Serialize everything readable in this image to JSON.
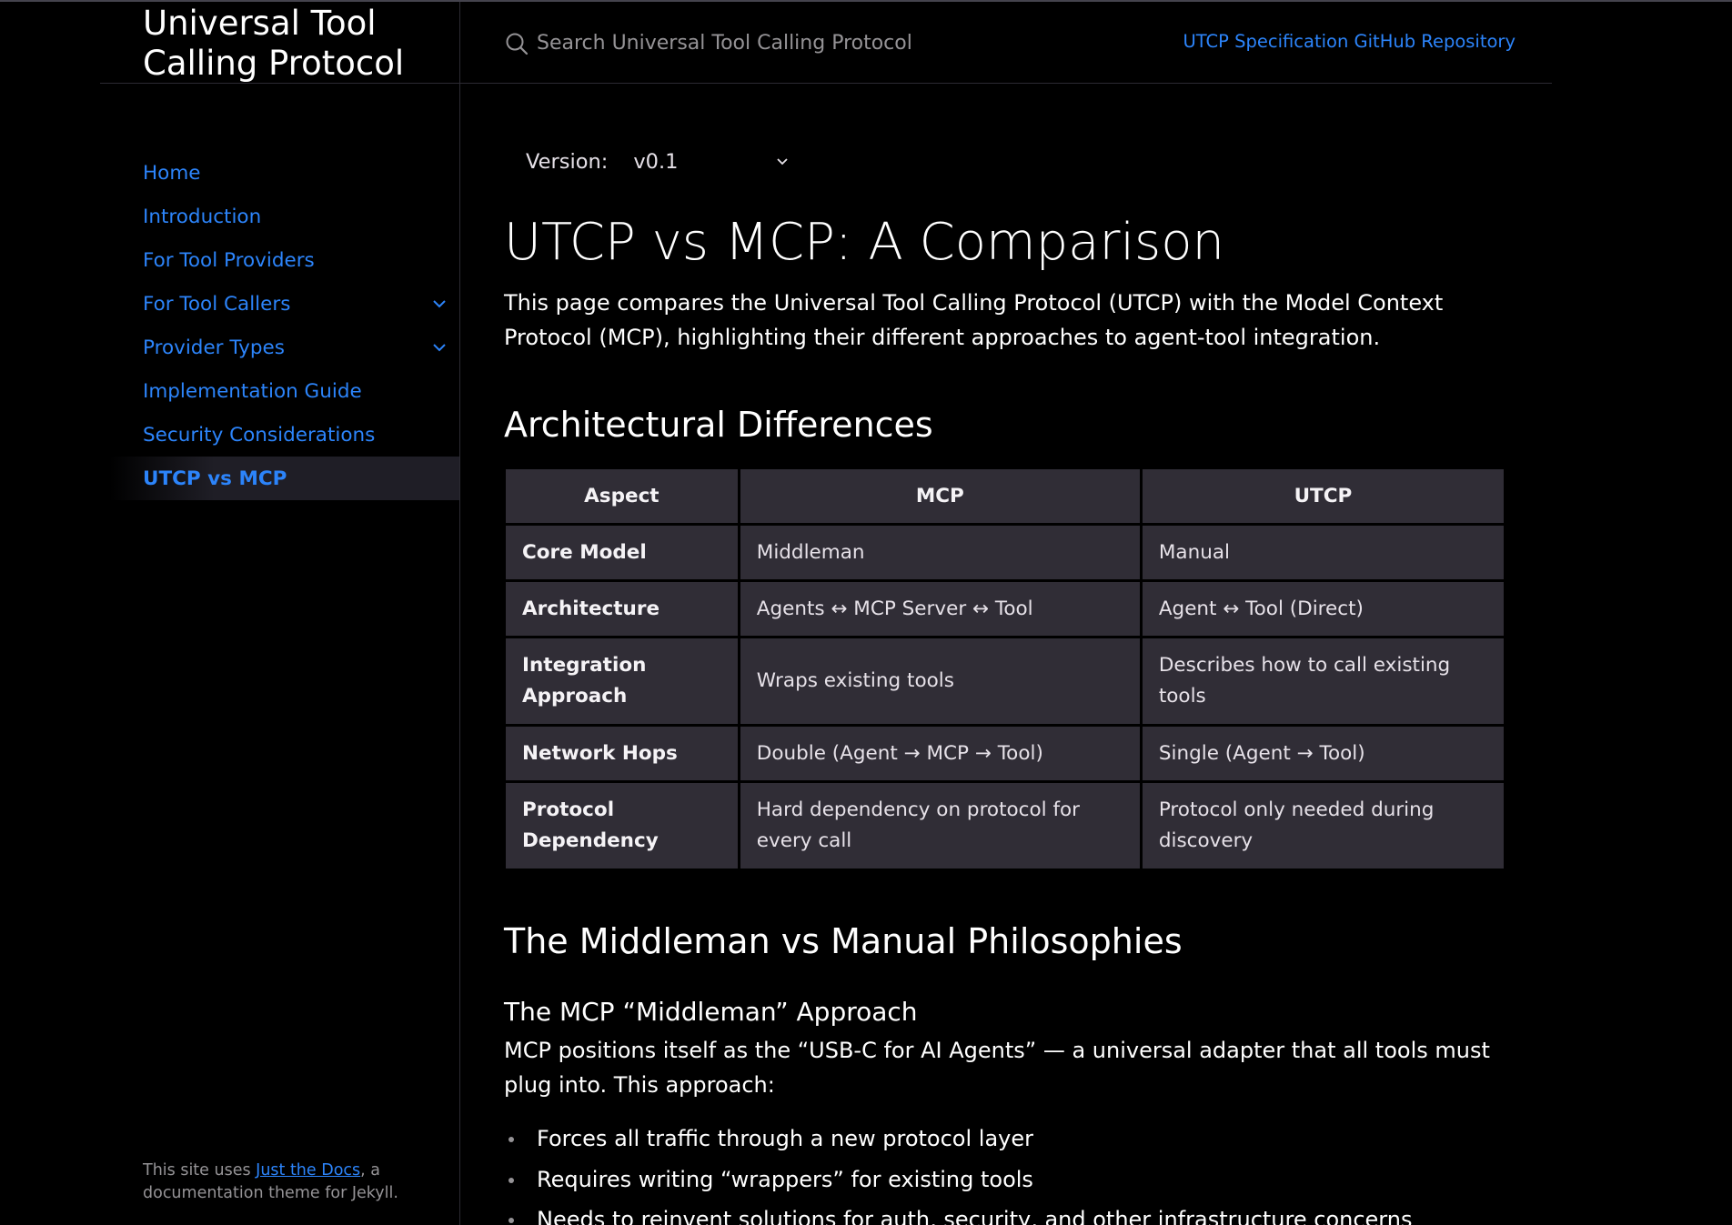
{
  "site": {
    "title": "Universal Tool Calling Protocol"
  },
  "header": {
    "search_placeholder": "Search Universal Tool Calling Protocol",
    "aux_link": "UTCP Specification GitHub Repository"
  },
  "sidebar": {
    "items": [
      {
        "label": "Home"
      },
      {
        "label": "Introduction"
      },
      {
        "label": "For Tool Providers"
      },
      {
        "label": "For Tool Callers"
      },
      {
        "label": "Provider Types"
      },
      {
        "label": "Implementation Guide"
      },
      {
        "label": "Security Considerations"
      },
      {
        "label": "UTCP vs MCP"
      }
    ],
    "footer": {
      "prefix": "This site uses ",
      "link": "Just the Docs",
      "suffix": ", a documentation theme for Jekyll."
    }
  },
  "version": {
    "label": "Version:",
    "selected": "v0.1"
  },
  "main": {
    "title": "UTCP vs MCP: A Comparison",
    "intro": "This page compares the Universal Tool Calling Protocol (UTCP) with the Model Context Protocol (MCP), highlighting their different approaches to agent-tool integration.",
    "section1_heading": "Architectural Differences",
    "table": {
      "headers": [
        "Aspect",
        "MCP",
        "UTCP"
      ],
      "rows": [
        [
          "Core Model",
          "Middleman",
          "Manual"
        ],
        [
          "Architecture",
          "Agents ↔ MCP Server ↔ Tool",
          "Agent ↔ Tool (Direct)"
        ],
        [
          "Integration Approach",
          "Wraps existing tools",
          "Describes how to call existing tools"
        ],
        [
          "Network Hops",
          "Double (Agent → MCP → Tool)",
          "Single (Agent → Tool)"
        ],
        [
          "Protocol Dependency",
          "Hard dependency on protocol for every call",
          "Protocol only needed during discovery"
        ]
      ]
    },
    "section2_heading": "The Middleman vs Manual Philosophies",
    "subheading": "The MCP “Middleman” Approach",
    "paragraph2": "MCP positions itself as the “USB-C for AI Agents” — a universal adapter that all tools must plug into. This approach:",
    "bullets": [
      "Forces all traffic through a new protocol layer",
      "Requires writing “wrappers” for existing tools",
      "Needs to reinvent solutions for auth, security, and other infrastructure concerns"
    ]
  },
  "colors": {
    "link": "#2c84fa",
    "table_cell": "#302d36",
    "background": "#000000"
  }
}
